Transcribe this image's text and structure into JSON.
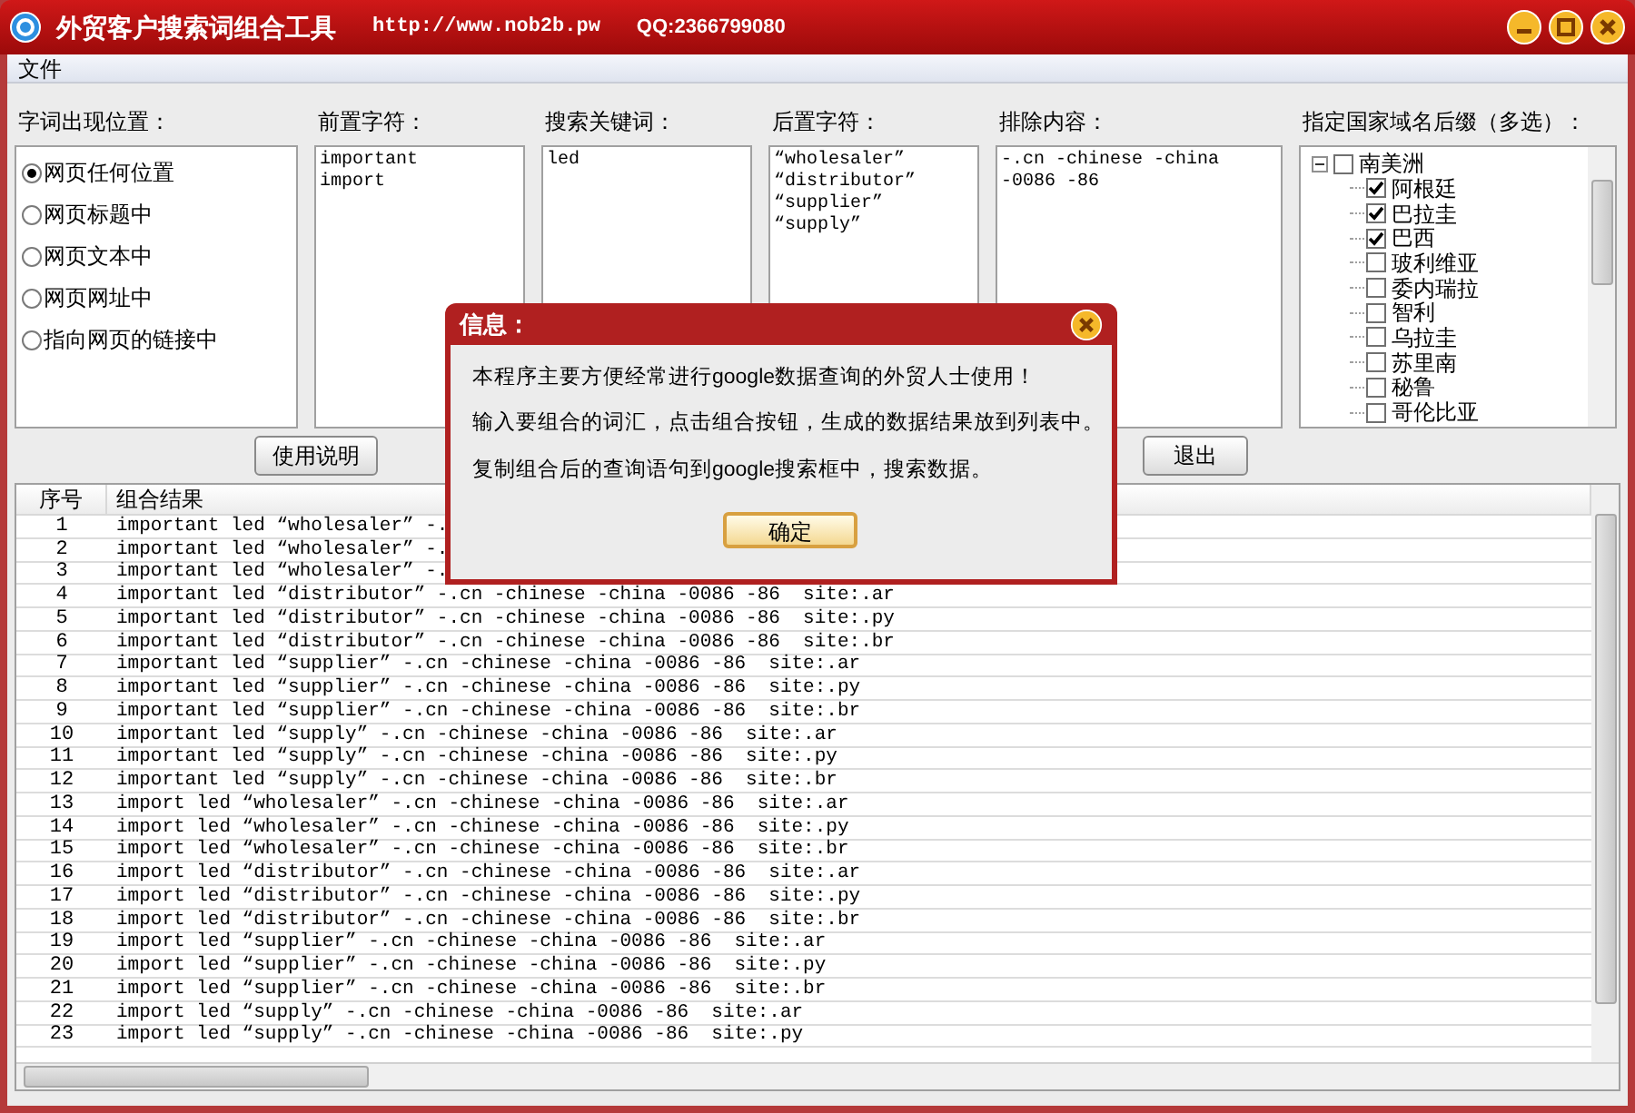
{
  "window": {
    "title": "外贸客户搜索词组合工具",
    "url": "http://www.nob2b.pw",
    "qq": "QQ:2366799080"
  },
  "menu": [
    "文件"
  ],
  "position": {
    "label": "字词出现位置：",
    "options": [
      {
        "label": "网页任何位置",
        "selected": true
      },
      {
        "label": "网页标题中",
        "selected": false
      },
      {
        "label": "网页文本中",
        "selected": false
      },
      {
        "label": "网页网址中",
        "selected": false
      },
      {
        "label": "指向网页的链接中",
        "selected": false
      }
    ]
  },
  "fields": [
    {
      "label": "前置字符：",
      "value": "important\nimport"
    },
    {
      "label": "搜索关键词：",
      "value": "led"
    },
    {
      "label": "后置字符：",
      "value": "“wholesaler”\n“distributor”\n“supplier”\n“supply”"
    },
    {
      "label": "排除内容：",
      "value": "-.cn -chinese -china -0086 -86"
    }
  ],
  "countries": {
    "label": "指定国家域名后缀（多选）：",
    "tree": [
      {
        "label": "南美洲",
        "checked": false,
        "expanded": true,
        "children": [
          {
            "label": "阿根廷",
            "checked": true
          },
          {
            "label": "巴拉圭",
            "checked": true
          },
          {
            "label": "巴西",
            "checked": true
          },
          {
            "label": "玻利维亚",
            "checked": false
          },
          {
            "label": "委内瑞拉",
            "checked": false
          },
          {
            "label": "智利",
            "checked": false
          },
          {
            "label": "乌拉圭",
            "checked": false
          },
          {
            "label": "苏里南",
            "checked": false
          },
          {
            "label": "秘鲁",
            "checked": false
          },
          {
            "label": "哥伦比亚",
            "checked": false
          }
        ]
      }
    ]
  },
  "buttons": [
    "使用说明",
    "退出"
  ],
  "table": {
    "columns": [
      "序号",
      "组合结果"
    ],
    "rows": [
      [
        "1",
        "important led “wholesaler” -."
      ],
      [
        "2",
        "important led “wholesaler” -."
      ],
      [
        "3",
        "important led “wholesaler” -."
      ],
      [
        "4",
        "important led “distributor” -.cn -chinese -china -0086 -86  site:.ar"
      ],
      [
        "5",
        "important led “distributor” -.cn -chinese -china -0086 -86  site:.py"
      ],
      [
        "6",
        "important led “distributor” -.cn -chinese -china -0086 -86  site:.br"
      ],
      [
        "7",
        "important led “supplier” -.cn -chinese -china -0086 -86  site:.ar"
      ],
      [
        "8",
        "important led “supplier” -.cn -chinese -china -0086 -86  site:.py"
      ],
      [
        "9",
        "important led “supplier” -.cn -chinese -china -0086 -86  site:.br"
      ],
      [
        "10",
        "important led “supply” -.cn -chinese -china -0086 -86  site:.ar"
      ],
      [
        "11",
        "important led “supply” -.cn -chinese -china -0086 -86  site:.py"
      ],
      [
        "12",
        "important led “supply” -.cn -chinese -china -0086 -86  site:.br"
      ],
      [
        "13",
        "import led “wholesaler” -.cn -chinese -china -0086 -86  site:.ar"
      ],
      [
        "14",
        "import led “wholesaler” -.cn -chinese -china -0086 -86  site:.py"
      ],
      [
        "15",
        "import led “wholesaler” -.cn -chinese -china -0086 -86  site:.br"
      ],
      [
        "16",
        "import led “distributor” -.cn -chinese -china -0086 -86  site:.ar"
      ],
      [
        "17",
        "import led “distributor” -.cn -chinese -china -0086 -86  site:.py"
      ],
      [
        "18",
        "import led “distributor” -.cn -chinese -china -0086 -86  site:.br"
      ],
      [
        "19",
        "import led “supplier” -.cn -chinese -china -0086 -86  site:.ar"
      ],
      [
        "20",
        "import led “supplier” -.cn -chinese -china -0086 -86  site:.py"
      ],
      [
        "21",
        "import led “supplier” -.cn -chinese -china -0086 -86  site:.br"
      ],
      [
        "22",
        "import led “supply” -.cn -chinese -china -0086 -86  site:.ar"
      ],
      [
        "23",
        "import led “supply” -.cn -chinese -china -0086 -86  site:.py"
      ]
    ]
  },
  "dialog": {
    "title": "信息：",
    "lines": [
      "本程序主要方便经常进行google数据查询的外贸人士使用！",
      "输入要组合的词汇，点击组合按钮，生成的数据结果放到列表中。",
      "复制组合后的查询语句到google搜索框中，搜索数据。"
    ],
    "button": "确定"
  }
}
